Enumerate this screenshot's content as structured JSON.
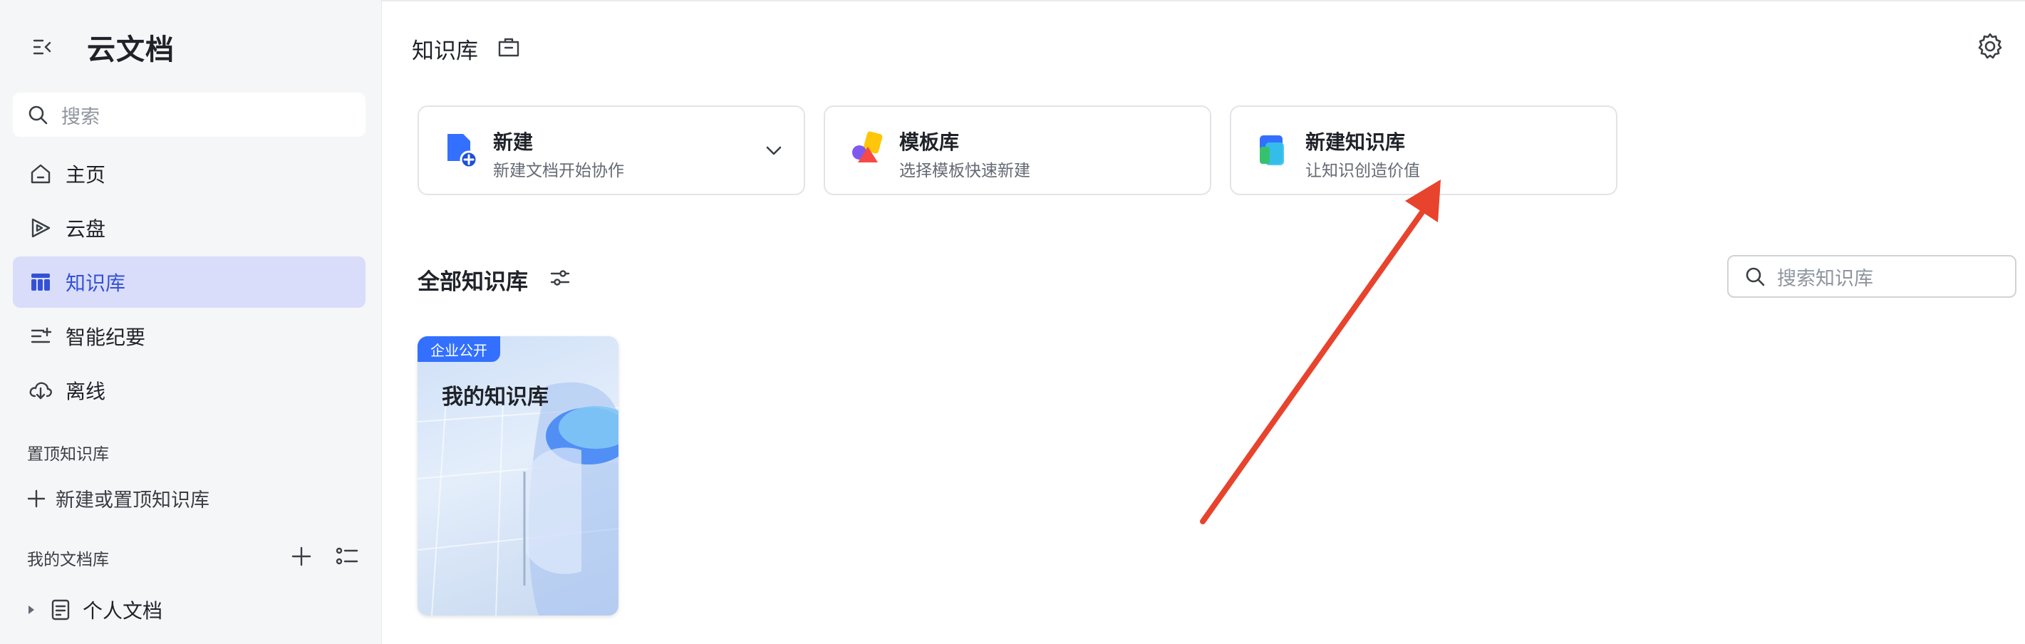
{
  "sidebar": {
    "title": "云文档",
    "search_placeholder": "搜索",
    "nav": [
      {
        "label": "主页",
        "icon": "home-icon"
      },
      {
        "label": "云盘",
        "icon": "cloud-drive-icon"
      },
      {
        "label": "知识库",
        "icon": "knowledge-base-icon",
        "active": true
      },
      {
        "label": "智能纪要",
        "icon": "smart-minutes-icon"
      },
      {
        "label": "离线",
        "icon": "offline-download-icon"
      }
    ],
    "pinned_section": "置顶知识库",
    "pinned_add": "新建或置顶知识库",
    "my_library_section": "我的文档库",
    "tree": [
      {
        "label": "个人文档",
        "icon": "document-icon"
      }
    ]
  },
  "main": {
    "title": "知识库",
    "cards": [
      {
        "title": "新建",
        "subtitle": "新建文档开始协作",
        "icon": "new-doc-icon",
        "has_dropdown": true
      },
      {
        "title": "模板库",
        "subtitle": "选择模板快速新建",
        "icon": "template-icon"
      },
      {
        "title": "新建知识库",
        "subtitle": "让知识创造价值",
        "icon": "new-knowledge-base-icon"
      }
    ],
    "section_title": "全部知识库",
    "kb_search_placeholder": "搜索知识库",
    "knowledge_bases": [
      {
        "tag": "企业公开",
        "name": "我的知识库"
      }
    ]
  },
  "colors": {
    "accent": "#3370ff",
    "active_nav_bg": "#d9ddfa",
    "active_nav_text": "#3451d6",
    "annotation_arrow": "#e8432d"
  }
}
